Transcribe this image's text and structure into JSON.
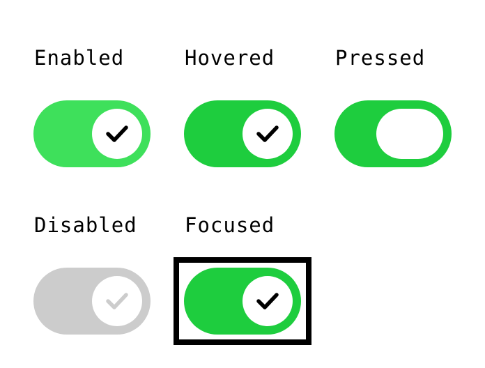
{
  "switches": [
    {
      "label": "Enabled",
      "state": "on",
      "variant": "enabled",
      "track_color": "#3ee05b",
      "check_color": "#000000",
      "show_check": true
    },
    {
      "label": "Hovered",
      "state": "on",
      "variant": "hovered",
      "track_color": "#1ecd3e",
      "check_color": "#000000",
      "show_check": true
    },
    {
      "label": "Pressed",
      "state": "on",
      "variant": "pressed",
      "track_color": "#1ecd3e",
      "check_color": "#000000",
      "show_check": false
    },
    {
      "label": "Disabled",
      "state": "on",
      "variant": "disabled",
      "track_color": "#cccccc",
      "check_color": "#cccccc",
      "show_check": true
    },
    {
      "label": "Focused",
      "state": "on",
      "variant": "focused",
      "track_color": "#1ecd3e",
      "check_color": "#000000",
      "show_check": true
    }
  ],
  "colors": {
    "thumb": "#ffffff",
    "focus_ring": "#000000",
    "label_text": "#000000"
  },
  "icons": {
    "thumb_icon": "check-icon"
  }
}
